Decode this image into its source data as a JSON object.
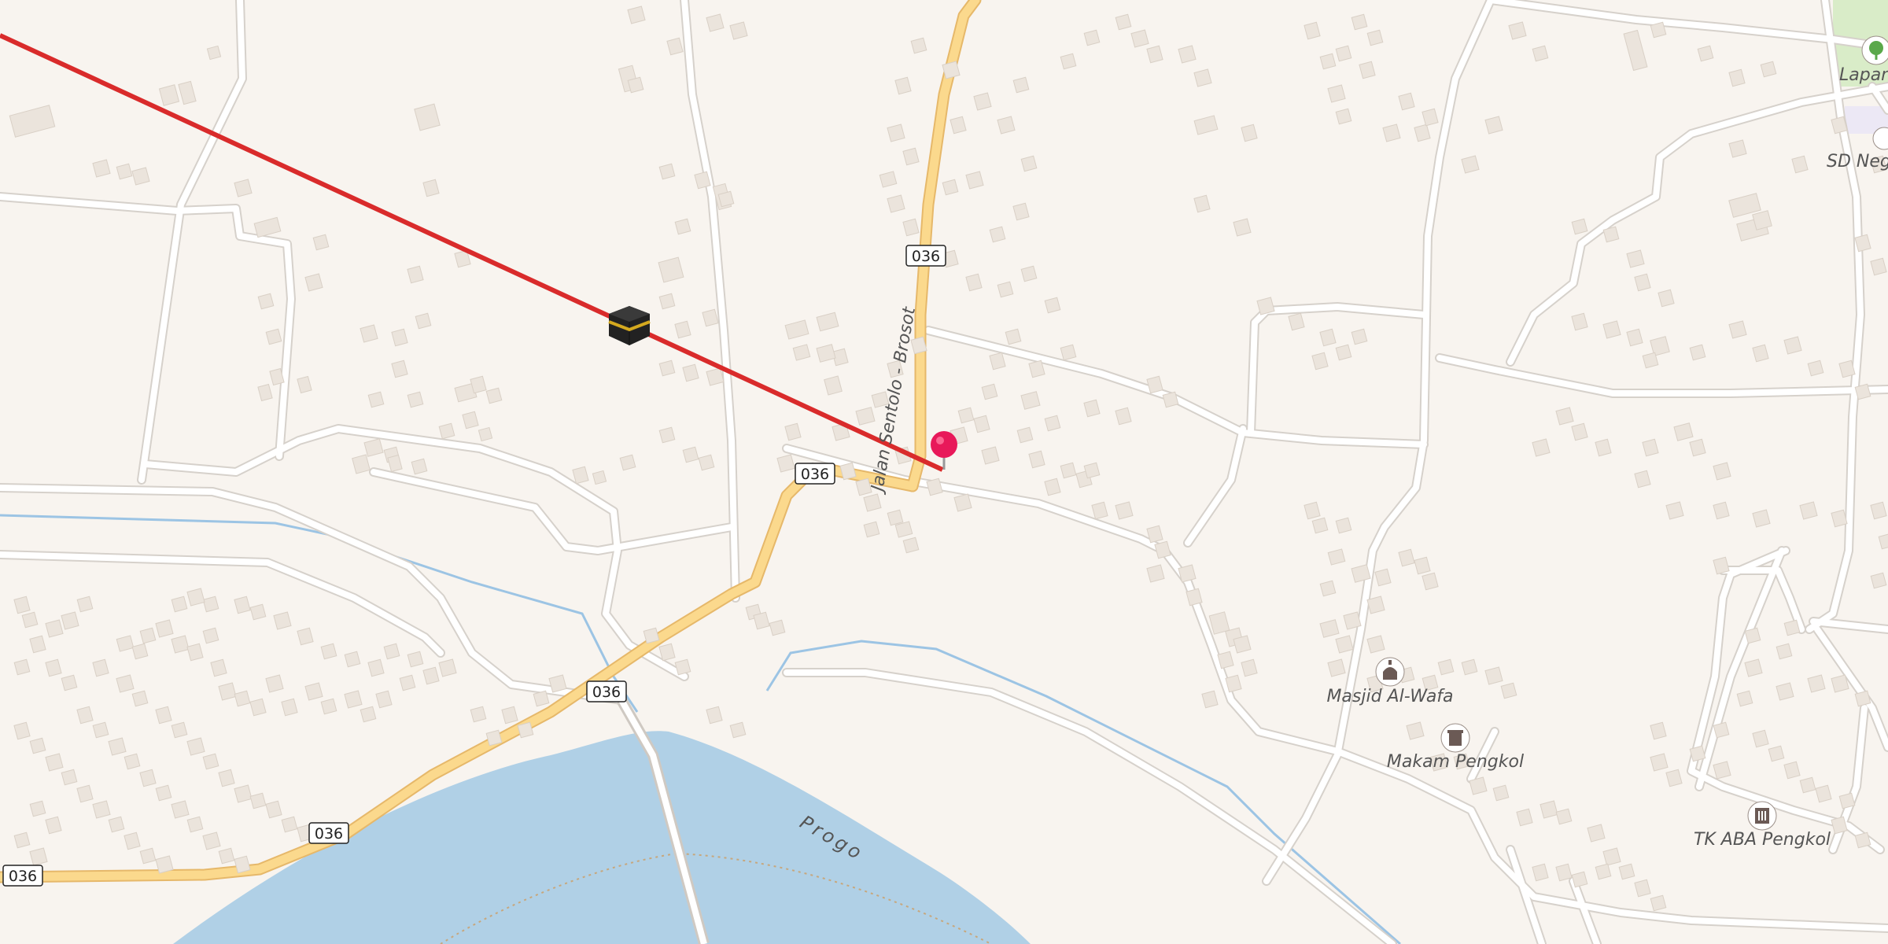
{
  "map": {
    "road_shields": [
      "036",
      "036",
      "036",
      "036",
      "036"
    ],
    "road_name": "Jalan Sentolo - Brosot",
    "river_name": "Progo",
    "pois": [
      {
        "name": "Masjid Al-Wafa",
        "icon": "mosque-icon"
      },
      {
        "name": "Makam Pengkol",
        "icon": "cemetery-icon"
      },
      {
        "name": "TK ABA Pengkol",
        "icon": "school-icon"
      },
      {
        "name": "Lapan",
        "icon": "park-tree-icon"
      },
      {
        "name": "SD Nege",
        "icon": "school-icon"
      }
    ],
    "markers": {
      "kaaba": "kaaba-icon",
      "pin": "location-pin-icon"
    },
    "colors": {
      "background": "#f8f4ef",
      "road_minor": "#ffffff",
      "road_minor_casing": "#d6d1cb",
      "road_main": "#fbd98d",
      "road_main_casing": "#e6b86a",
      "water": "#b0d0e6",
      "building": "#ebe4dc",
      "qibla_line": "#d92b2b",
      "pin": "#e8195a"
    }
  }
}
